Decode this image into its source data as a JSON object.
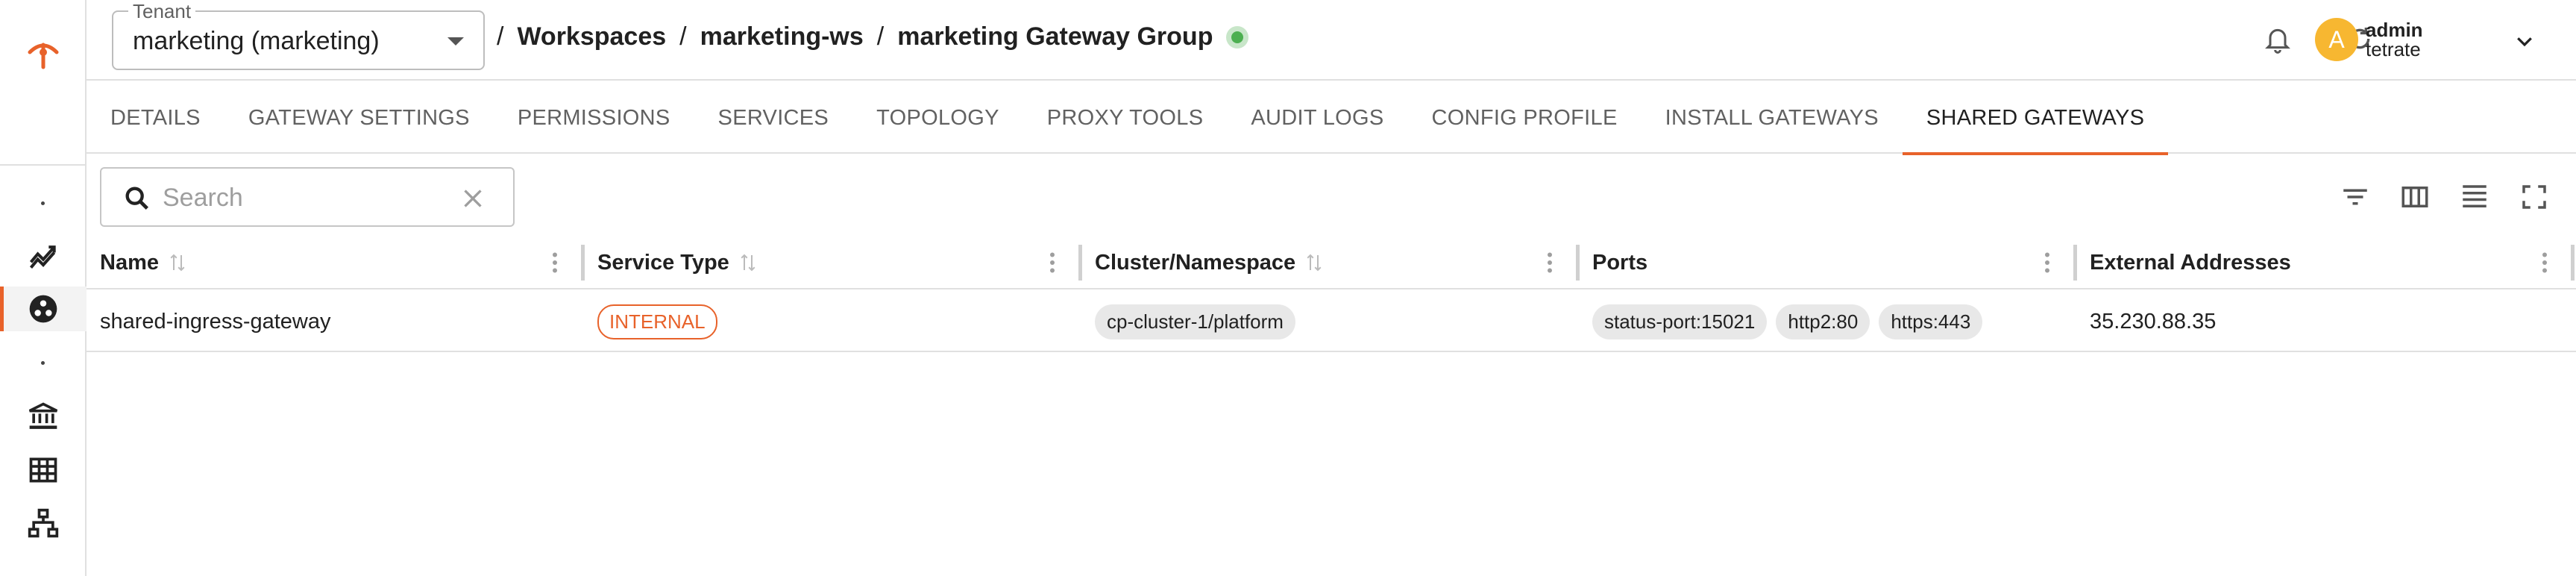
{
  "brand": {
    "accent": "#e8622a",
    "status_green": "#4caf50",
    "avatar_color": "#f7b731"
  },
  "sidebar": {
    "icons": [
      "logo-icon",
      "dot",
      "metrics-icon",
      "workspaces-icon",
      "dot",
      "bank-icon",
      "grid-icon",
      "hierarchy-icon"
    ],
    "active": "workspaces-icon"
  },
  "header": {
    "tenant_label": "Tenant",
    "tenant_value": "marketing (marketing)",
    "breadcrumb": {
      "sep": "/",
      "items": [
        "Workspaces",
        "marketing-ws",
        "marketing Gateway Group"
      ]
    },
    "status": "healthy",
    "user": {
      "initial": "A",
      "name": "admin",
      "org": "tetrate"
    }
  },
  "tabs": [
    {
      "label": "DETAILS"
    },
    {
      "label": "GATEWAY SETTINGS"
    },
    {
      "label": "PERMISSIONS"
    },
    {
      "label": "SERVICES"
    },
    {
      "label": "TOPOLOGY"
    },
    {
      "label": "PROXY TOOLS"
    },
    {
      "label": "AUDIT LOGS"
    },
    {
      "label": "CONFIG PROFILE"
    },
    {
      "label": "INSTALL GATEWAYS"
    },
    {
      "label": "SHARED GATEWAYS",
      "active": true
    }
  ],
  "search": {
    "placeholder": "Search",
    "value": ""
  },
  "table": {
    "columns": [
      "Name",
      "Service Type",
      "Cluster/Namespace",
      "Ports",
      "External Addresses"
    ],
    "rows": [
      {
        "name": "shared-ingress-gateway",
        "service_type": "INTERNAL",
        "cluster_namespace": "cp-cluster-1/platform",
        "ports": [
          "status-port:15021",
          "http2:80",
          "https:443"
        ],
        "external_addresses": "35.230.88.35"
      }
    ]
  }
}
